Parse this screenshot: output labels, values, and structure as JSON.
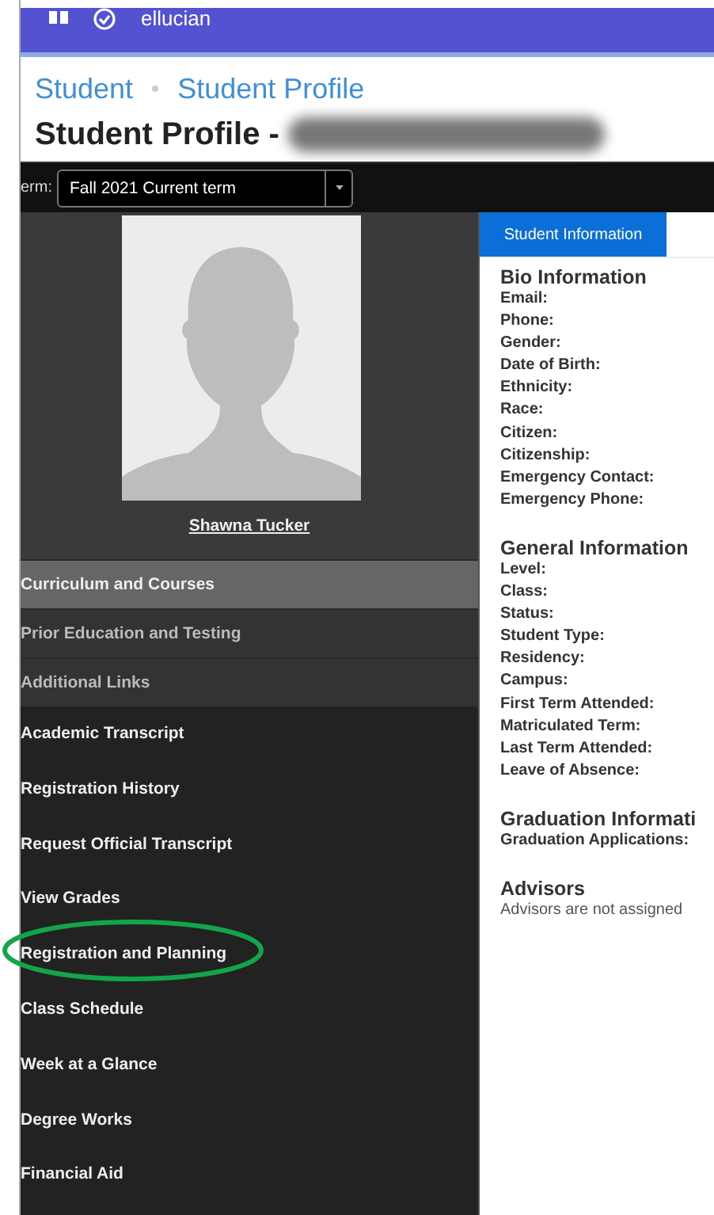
{
  "brand": "ellucian",
  "breadcrumbs": [
    "Student",
    "Student Profile"
  ],
  "page_title": "Student Profile -",
  "term": {
    "label": "erm:",
    "value": "Fall 2021 Current term"
  },
  "profile": {
    "name": "Shawna Tucker"
  },
  "sections": [
    {
      "label": "Curriculum and Courses",
      "selected": true
    },
    {
      "label": "Prior Education and Testing",
      "selected": false
    },
    {
      "label": "Additional Links",
      "selected": false
    }
  ],
  "links": [
    {
      "label": "Academic Transcript",
      "circled": false
    },
    {
      "label": "Registration History",
      "circled": false
    },
    {
      "label": "Request Official Transcript",
      "circled": false
    },
    {
      "label": "View Grades",
      "circled": false
    },
    {
      "label": "Registration and Planning",
      "circled": true
    },
    {
      "label": "Class Schedule",
      "circled": false
    },
    {
      "label": "Week at a Glance",
      "circled": false
    },
    {
      "label": "Degree Works",
      "circled": false
    },
    {
      "label": "Financial Aid",
      "circled": false
    }
  ],
  "tabs": [
    {
      "label": "Student Information",
      "selected": true
    }
  ],
  "info_groups": [
    {
      "title": "Bio Information",
      "fields": [
        "Email:",
        "Phone:",
        "Gender:",
        "Date of Birth:",
        "Ethnicity:",
        "Race:",
        "Citizen:",
        "Citizenship:",
        "Emergency Contact:",
        "Emergency Phone:"
      ]
    },
    {
      "title": "General Information",
      "fields": [
        "Level:",
        "Class:",
        "Status:",
        "Student Type:",
        "Residency:",
        "Campus:",
        "First Term Attended:",
        "Matriculated Term:",
        "Last Term Attended:",
        "Leave of Absence:"
      ]
    },
    {
      "title": "Graduation Informati",
      "fields": [
        "Graduation Applications:"
      ]
    },
    {
      "title": "Advisors",
      "note": "Advisors are not assigned"
    }
  ]
}
